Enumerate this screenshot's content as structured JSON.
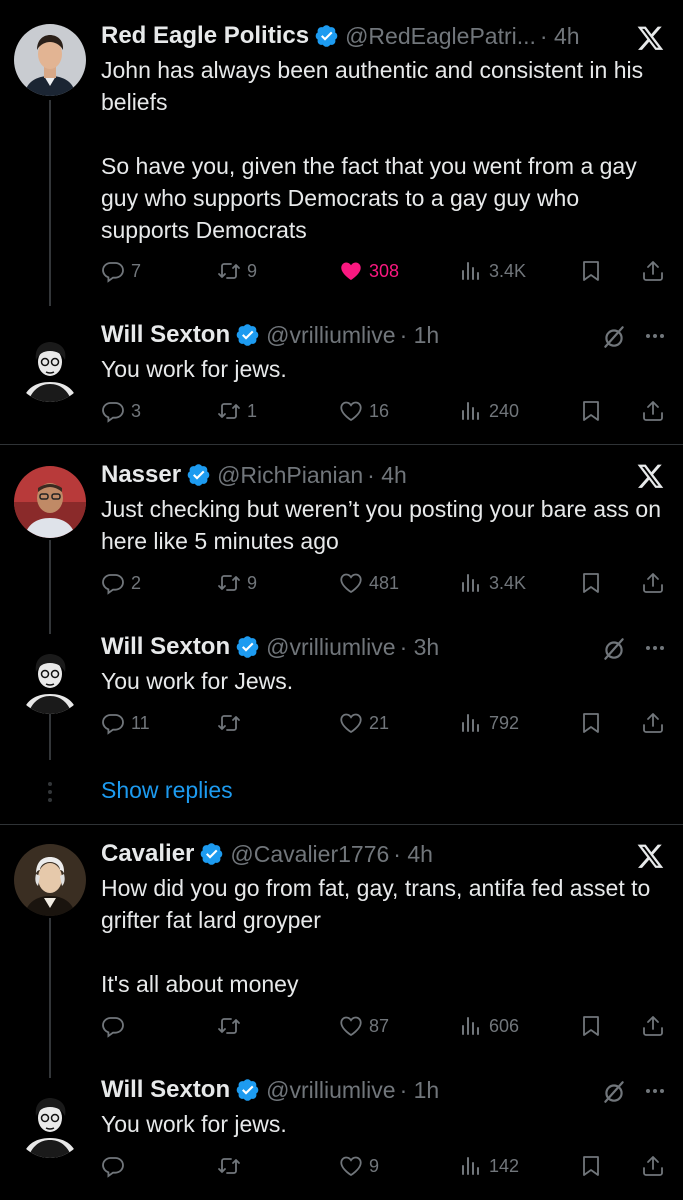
{
  "tweets": [
    {
      "name": "Red Eagle Politics",
      "handle": "@RedEaglePatri...",
      "time": "· 4h",
      "text": "John has always been authentic and consistent in his beliefs\n\nSo have you, given the fact that you went from a gay guy who supports Democrats to a gay guy who supports Democrats",
      "replies": "7",
      "reposts": "9",
      "likes": "308",
      "views": "3.4K"
    },
    {
      "name": "Will Sexton",
      "handle": "@vrilliumlive",
      "time": "· 1h",
      "text": "You work for jews.",
      "replies": "3",
      "reposts": "1",
      "likes": "16",
      "views": "240"
    },
    {
      "name": "Nasser",
      "handle": "@RichPianian",
      "time": "· 4h",
      "text": "Just checking but weren’t you posting your bare ass on here like 5 minutes ago",
      "replies": "2",
      "reposts": "9",
      "likes": "481",
      "views": "3.4K"
    },
    {
      "name": "Will Sexton",
      "handle": "@vrilliumlive",
      "time": "· 3h",
      "text": "You work for Jews.",
      "replies": "11",
      "reposts": "",
      "likes": "21",
      "views": "792"
    },
    {
      "name": "Cavalier",
      "handle": "@Cavalier1776",
      "time": "· 4h",
      "text": "How did you go from fat, gay, trans, antifa fed asset to grifter fat lard groyper\n\nIt's all about money",
      "replies": "",
      "reposts": "",
      "likes": "87",
      "views": "606"
    },
    {
      "name": "Will Sexton",
      "handle": "@vrilliumlive",
      "time": "· 1h",
      "text": "You work for jews.",
      "replies": "",
      "reposts": "",
      "likes": "9",
      "views": "142"
    }
  ],
  "show_replies": "Show replies",
  "colors": {
    "accent": "#1d9bf0",
    "like": "#f91880",
    "muted": "#71767b",
    "background": "#000000"
  }
}
